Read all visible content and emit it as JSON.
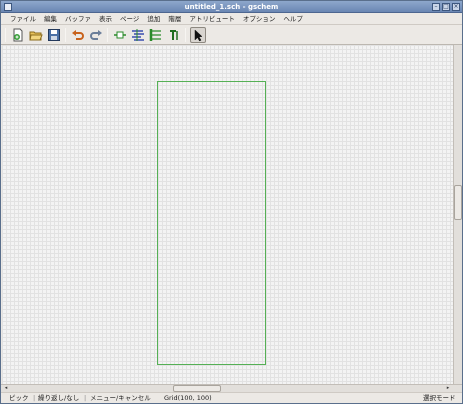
{
  "window": {
    "title": "untitled_1.sch - gschem",
    "minimize_glyph": "–",
    "maximize_glyph": "□",
    "close_glyph": "×"
  },
  "menubar": {
    "items": [
      "ファイル",
      "編集",
      "バッファ",
      "表示",
      "ページ",
      "追加",
      "階層",
      "アトリビュート",
      "オプション",
      "ヘルプ"
    ]
  },
  "toolbar": {
    "buttons": [
      {
        "name": "new-file-icon"
      },
      {
        "name": "open-folder-icon"
      },
      {
        "name": "save-icon"
      },
      {
        "name": "undo-icon"
      },
      {
        "name": "redo-icon"
      },
      {
        "name": "add-component-icon"
      },
      {
        "name": "add-net-icon"
      },
      {
        "name": "add-bus-icon"
      },
      {
        "name": "add-text-icon"
      },
      {
        "name": "select-arrow-icon"
      }
    ],
    "selected": "select-arrow-icon"
  },
  "canvas": {
    "grid_color": "#e2e2e2",
    "frame_color": "#55b055"
  },
  "statusbar": {
    "pick": "ピック",
    "repeat": "繰り返し/なし",
    "menu_cancel": "メニュー/キャンセル",
    "grid": "Grid(100, 100)",
    "mode": "選択モード"
  }
}
